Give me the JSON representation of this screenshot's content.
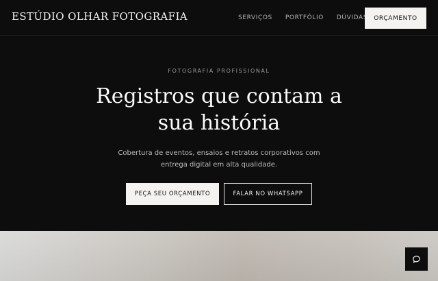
{
  "brand": {
    "name": "ESTÚDIO OLHAR FOTOGRAFIA"
  },
  "nav": {
    "links": [
      "SERVIÇOS",
      "PORTFÓLIO",
      "DÚVIDAS"
    ],
    "cta_label": "ORÇAMENTO"
  },
  "hero": {
    "eyebrow": "FOTOGRAFIA PROFISSIONAL",
    "headline_lines": [
      "Registros que contam a",
      "sua história"
    ],
    "sub_lines": [
      "Cobertura de eventos, ensaios e retratos corporativos com",
      "entrega digital em alta qualidade."
    ],
    "primary_button": "PEÇA SEU ORÇAMENTO",
    "secondary_button": "FALAR NO WHATSAPP"
  },
  "chat": {
    "icon": "chat-bubble-icon"
  },
  "colors": {
    "background": "#0d0d0d",
    "button_light": "#f5f3ef",
    "text": "#ffffff"
  }
}
